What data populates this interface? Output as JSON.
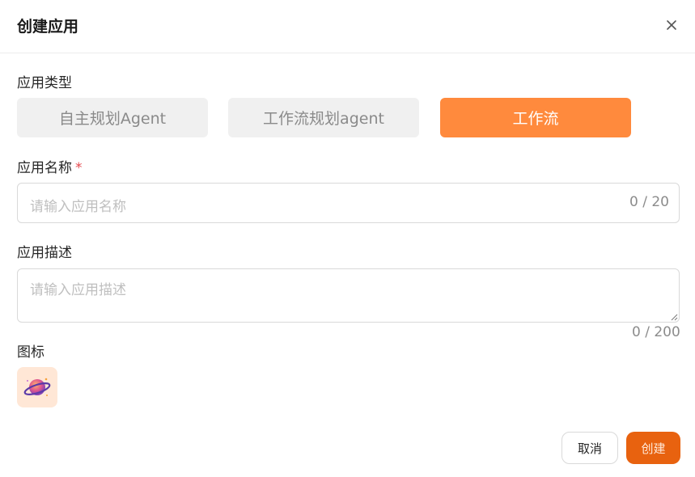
{
  "dialog": {
    "title": "创建应用"
  },
  "app_type": {
    "label": "应用类型",
    "options": [
      {
        "label": "自主规划Agent",
        "selected": false
      },
      {
        "label": "工作流规划agent",
        "selected": false
      },
      {
        "label": "工作流",
        "selected": true
      }
    ]
  },
  "app_name": {
    "label": "应用名称",
    "required_mark": "*",
    "placeholder": "请输入应用名称",
    "value": "",
    "counter": "0 / 20"
  },
  "app_desc": {
    "label": "应用描述",
    "placeholder": "请输入应用描述",
    "value": "",
    "counter": "0 / 200"
  },
  "icon_field": {
    "label": "图标",
    "icon": "planet-icon"
  },
  "footer": {
    "cancel_label": "取消",
    "create_label": "创建"
  },
  "colors": {
    "accent": "#ff8a3d",
    "primary_button": "#e8620f",
    "required": "#e5484d"
  }
}
